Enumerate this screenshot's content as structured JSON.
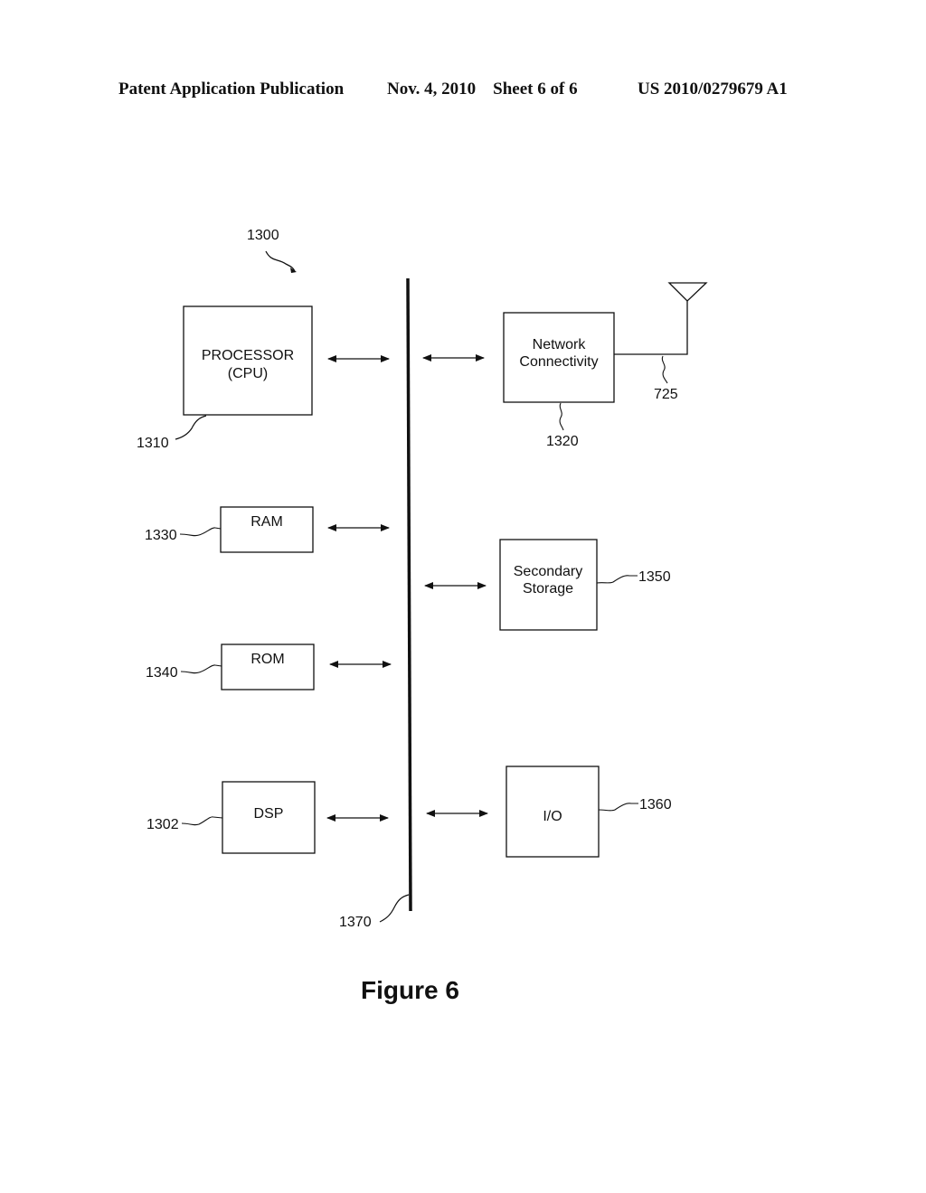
{
  "header": {
    "publication": "Patent Application Publication",
    "date_sheet": "Nov. 4, 2010    Sheet 6 of 6",
    "number": "US 2010/0279679 A1"
  },
  "diagram": {
    "system_ref": "1300",
    "bus_ref": "1370",
    "blocks": {
      "processor": {
        "line1": "PROCESSOR",
        "line2": "(CPU)",
        "ref": "1310"
      },
      "network": {
        "line1": "Network",
        "line2": "Connectivity",
        "ref": "1320",
        "antenna_ref": "725"
      },
      "ram": {
        "line1": "RAM",
        "ref": "1330"
      },
      "secondary": {
        "line1": "Secondary",
        "line2": "Storage",
        "ref": "1350"
      },
      "rom": {
        "line1": "ROM",
        "ref": "1340"
      },
      "dsp": {
        "line1": "DSP",
        "ref": "1302"
      },
      "io": {
        "line1": "I/O",
        "ref": "1360"
      }
    },
    "caption": "Figure 6"
  }
}
